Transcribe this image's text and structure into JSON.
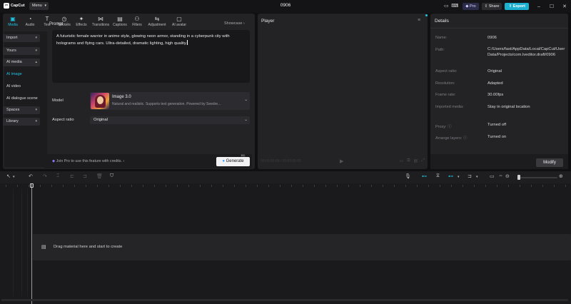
{
  "titlebar": {
    "logo": "CapCut",
    "menu_label": "Menu",
    "project_title": "0906",
    "pro_label": "Pro",
    "share_label": "Share",
    "export_label": "Export"
  },
  "media_tabs": [
    {
      "label": "Media",
      "icon": "media-icon"
    },
    {
      "label": "Audio",
      "icon": "audio-icon"
    },
    {
      "label": "Text",
      "icon": "text-icon"
    },
    {
      "label": "Stickers",
      "icon": "stickers-icon"
    },
    {
      "label": "Effects",
      "icon": "effects-icon"
    },
    {
      "label": "Transitions",
      "icon": "transitions-icon"
    },
    {
      "label": "Captions",
      "icon": "captions-icon"
    },
    {
      "label": "Filters",
      "icon": "filters-icon"
    },
    {
      "label": "Adjustment",
      "icon": "adjustment-icon"
    },
    {
      "label": "AI avatar",
      "icon": "ai-avatar-icon"
    }
  ],
  "leftnav": {
    "import": "Import",
    "yours": "Yours",
    "ai_media": "AI media",
    "ai_image": "AI image",
    "ai_video": "AI video",
    "ai_dialogue": "AI dialogue scene",
    "spaces": "Spaces",
    "library": "Library"
  },
  "prompt": {
    "label": "Prompt",
    "showcase": "Showcase",
    "text": "A futuristic female warrior in anime style, glowing neon armor, standing in a cyberpunk city with holograms and flying cars. Ultra-detailed, dramatic lighting, high quality."
  },
  "model": {
    "label": "Model",
    "name": "Image 3.0",
    "description": "Natural and realistic. Supports text generation. Powered by Seedre..."
  },
  "aspect": {
    "label": "Aspect ratio",
    "value": "Original"
  },
  "footer": {
    "pro_note": "Join Pro to use this feature with credits.",
    "generate_label": "Generate",
    "generate_badge": "0.1"
  },
  "player": {
    "title": "Player",
    "timecode": "00:00:00:00 / 00:00:00:00"
  },
  "details": {
    "title": "Details",
    "rows": [
      {
        "key": "Name:",
        "value": "0906"
      },
      {
        "key": "Path:",
        "value": "C:/Users/fast/AppData/Local/CapCut/User Data/Projects/com.lveditor.draft/0906"
      },
      {
        "key": "Aspect ratio:",
        "value": "Original"
      },
      {
        "key": "Resolution:",
        "value": "Adapted"
      },
      {
        "key": "Frame rate:",
        "value": "30.00fps"
      },
      {
        "key": "Imported media:",
        "value": "Stay in original location"
      },
      {
        "key": "Proxy:",
        "value": "Turned off"
      },
      {
        "key": "Arrange layers:",
        "value": "Turned on"
      }
    ],
    "modify_label": "Modify"
  },
  "timeline": {
    "drop_hint": "Drag material here and start to create"
  },
  "colors": {
    "accent": "#1fc2e0",
    "panel": "#232326",
    "background": "#101012"
  }
}
